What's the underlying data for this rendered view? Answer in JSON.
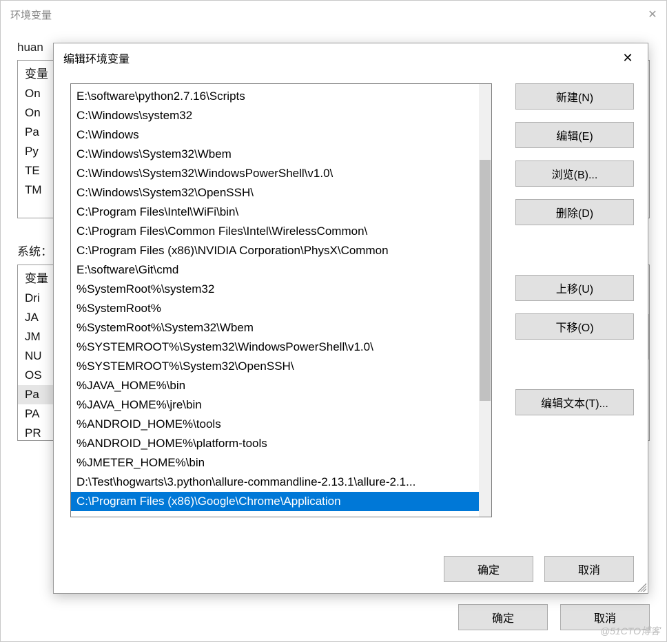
{
  "back": {
    "title": "环境变量",
    "user_header": "huan",
    "system_header": "系统：",
    "user_vars_col": "变量",
    "user_rows": [
      "On",
      "On",
      "Pa",
      "Py",
      "TE",
      "TM"
    ],
    "system_vars_col": "变量",
    "system_rows": [
      "Dri",
      "JA",
      "JM",
      "NU",
      "OS",
      "Pa",
      "PA",
      "PR"
    ],
    "system_selected_index": 5,
    "ok": "确定",
    "cancel": "取消"
  },
  "front": {
    "title": "编辑环境变量",
    "paths": [
      "E:\\software\\python2.7.16\\Scripts",
      "C:\\Windows\\system32",
      "C:\\Windows",
      "C:\\Windows\\System32\\Wbem",
      "C:\\Windows\\System32\\WindowsPowerShell\\v1.0\\",
      "C:\\Windows\\System32\\OpenSSH\\",
      "C:\\Program Files\\Intel\\WiFi\\bin\\",
      "C:\\Program Files\\Common Files\\Intel\\WirelessCommon\\",
      "C:\\Program Files (x86)\\NVIDIA Corporation\\PhysX\\Common",
      "E:\\software\\Git\\cmd",
      "%SystemRoot%\\system32",
      "%SystemRoot%",
      "%SystemRoot%\\System32\\Wbem",
      "%SYSTEMROOT%\\System32\\WindowsPowerShell\\v1.0\\",
      "%SYSTEMROOT%\\System32\\OpenSSH\\",
      "%JAVA_HOME%\\bin",
      "%JAVA_HOME%\\jre\\bin",
      "%ANDROID_HOME%\\tools",
      "%ANDROID_HOME%\\platform-tools",
      "%JMETER_HOME%\\bin",
      "D:\\Test\\hogwarts\\3.python\\allure-commandline-2.13.1\\allure-2.1...",
      "C:\\Program Files (x86)\\Google\\Chrome\\Application"
    ],
    "selected_index": 21,
    "buttons": {
      "new": "新建(N)",
      "edit": "编辑(E)",
      "browse": "浏览(B)...",
      "delete": "删除(D)",
      "up": "上移(U)",
      "down": "下移(O)",
      "edit_text": "编辑文本(T)...",
      "ok": "确定",
      "cancel": "取消"
    }
  },
  "watermark": "@51CTO博客"
}
